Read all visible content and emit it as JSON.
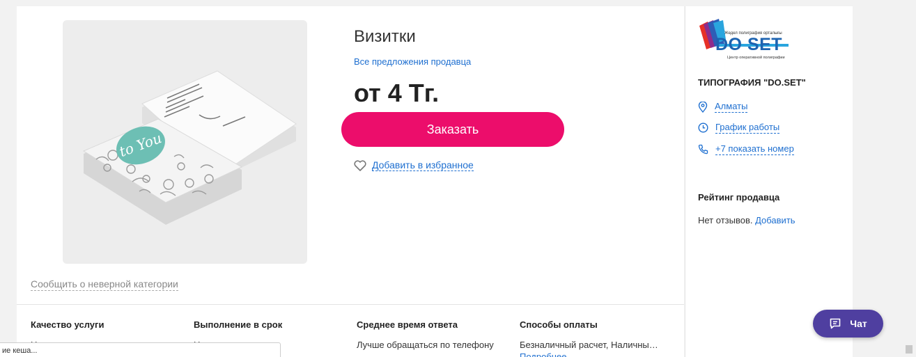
{
  "product": {
    "title": "Визитки",
    "seller_offers_link": "Все предложения продавца",
    "price": "от 4 Тг.",
    "order_button": "Заказать",
    "favorite_link": "Добавить в избранное",
    "report_link": "Сообщить о неверной категории"
  },
  "stats": [
    {
      "title": "Качество услуги",
      "value": "Нет оценок"
    },
    {
      "title": "Выполнение в срок",
      "value": "Нет оценок"
    },
    {
      "title": "Среднее время ответа",
      "value": "Лучше обращаться по телефону"
    },
    {
      "title": "Способы оплаты",
      "value": "Безналичный расчет, Наличны…",
      "more": "Подробнее"
    }
  ],
  "seller": {
    "logo_text": "DO SET",
    "logo_top_text": "Жедел полиграфия орталығы",
    "logo_bottom_text": "Центр оперативной полиграфии",
    "name": "ТИПОГРАФИЯ \"DO.SET\"",
    "city": "Алматы",
    "schedule": "График работы",
    "phone": "+7 показать номер",
    "rating_title": "Рейтинг продавца",
    "rating_text": "Нет отзывов.",
    "rating_add": "Добавить"
  },
  "chat": {
    "label": "Чат"
  },
  "cache_box": {
    "text": "ие кеша..."
  },
  "colors": {
    "accent": "#ec0d6b",
    "link": "#1e6fd0",
    "chat": "#4f3fa0"
  },
  "icons": [
    "location-icon",
    "clock-icon",
    "phone-icon",
    "heart-icon",
    "chat-icon"
  ]
}
